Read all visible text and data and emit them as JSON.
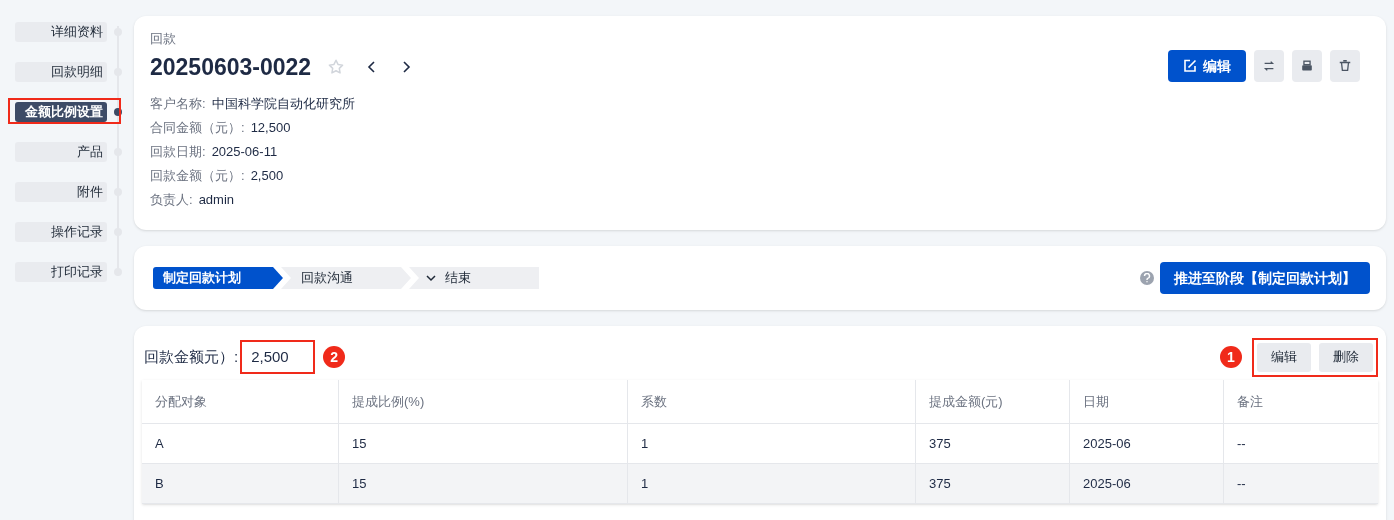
{
  "sidebar": {
    "items": [
      {
        "label": "详细资料",
        "selected": false,
        "annotated": false
      },
      {
        "label": "回款明细",
        "selected": false,
        "annotated": false
      },
      {
        "label": "金额比例设置",
        "selected": true,
        "annotated": true
      },
      {
        "label": "产品",
        "selected": false,
        "annotated": false
      },
      {
        "label": "附件",
        "selected": false,
        "annotated": false
      },
      {
        "label": "操作记录",
        "selected": false,
        "annotated": false
      },
      {
        "label": "打印记录",
        "selected": false,
        "annotated": false
      }
    ]
  },
  "header": {
    "category": "回款",
    "title": "20250603-0022",
    "starred": false,
    "fields": [
      {
        "label": "客户名称:",
        "value": "中国科学院自动化研究所"
      },
      {
        "label": "合同金额（元）:",
        "value": "12,500"
      },
      {
        "label": "回款日期:",
        "value": "2025-06-11"
      },
      {
        "label": "回款金额（元）:",
        "value": "2,500"
      },
      {
        "label": "负责人:",
        "value": "admin"
      }
    ],
    "actions": [
      {
        "kind": "primary",
        "label": "编辑"
      },
      {
        "kind": "swap"
      },
      {
        "kind": "print"
      },
      {
        "kind": "delete"
      }
    ]
  },
  "stages": {
    "steps": [
      {
        "label": "制定回款计划",
        "selected": true,
        "has_menu": false
      },
      {
        "label": "回款沟通",
        "selected": false,
        "has_menu": false
      },
      {
        "label": "结束",
        "selected": false,
        "has_menu": true
      }
    ],
    "advance_button": "推进至阶段【制定回款计划】"
  },
  "allocation": {
    "label": "回款金额元）:",
    "amount": "2,500",
    "amount_callout": "2",
    "buttons": [
      "编辑",
      "删除"
    ],
    "buttons_callout": "1",
    "columns": [
      "分配对象",
      "提成比例(%)",
      "系数",
      "提成金额(元)",
      "日期",
      "备注"
    ],
    "rows": [
      [
        "A",
        "15",
        "1",
        "375",
        "2025-06",
        "--"
      ],
      [
        "B",
        "15",
        "1",
        "375",
        "2025-06",
        "--"
      ]
    ]
  }
}
